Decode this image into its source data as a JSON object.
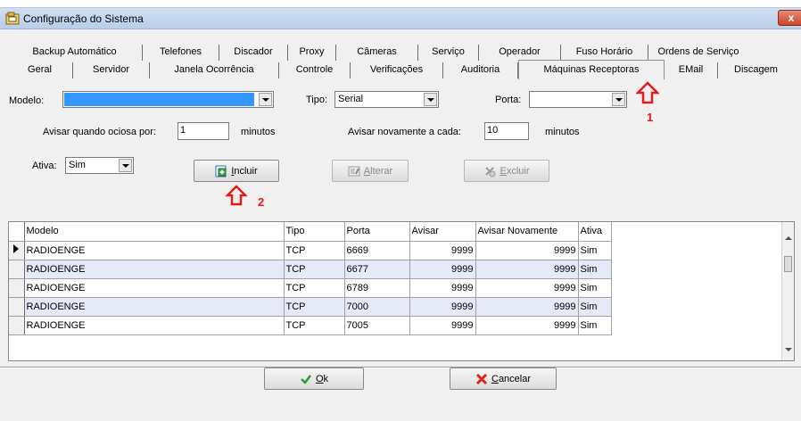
{
  "window": {
    "title": "Configuração do Sistema",
    "close_label": "x"
  },
  "tabs_row1": [
    "Backup Automático",
    "Telefones",
    "Discador",
    "Proxy",
    "Câmeras",
    "Serviço",
    "Operador",
    "Fuso Horário",
    "Ordens de Serviço"
  ],
  "tabs_row2": [
    "Geral",
    "Servidor",
    "Janela Ocorrência",
    "Controle",
    "Verificações",
    "Auditoria",
    "Máquinas Receptoras",
    "EMail",
    "Discagem"
  ],
  "active_tab": "Máquinas Receptoras",
  "form": {
    "modelo_label": "Modelo:",
    "modelo_value": "",
    "tipo_label": "Tipo:",
    "tipo_value": "Serial",
    "porta_label": "Porta:",
    "porta_value": "",
    "ociosa_label": "Avisar quando ociosa por:",
    "ociosa_value": "1",
    "minutos1": "minutos",
    "novamente_label": "Avisar novamente a cada:",
    "novamente_value": "10",
    "minutos2": "minutos",
    "ativa_label": "Ativa:",
    "ativa_value": "Sim"
  },
  "buttons": {
    "incluir": {
      "u": "I",
      "rest": "ncluir"
    },
    "alterar": {
      "u": "A",
      "rest": "lterar"
    },
    "excluir": {
      "u": "E",
      "rest": "xcluir"
    },
    "ok": {
      "u": "O",
      "rest": "k"
    },
    "cancelar": {
      "u": "C",
      "rest": "ancelar"
    }
  },
  "annotations": {
    "one": "1",
    "two": "2"
  },
  "table": {
    "headers": [
      "Modelo",
      "Tipo",
      "Porta",
      "Avisar",
      "Avisar Novamente",
      "Ativa"
    ],
    "rows": [
      [
        "RADIOENGE",
        "TCP",
        "6669",
        "9999",
        "9999",
        "Sim"
      ],
      [
        "RADIOENGE",
        "TCP",
        "6677",
        "9999",
        "9999",
        "Sim"
      ],
      [
        "RADIOENGE",
        "TCP",
        "6789",
        "9999",
        "9999",
        "Sim"
      ],
      [
        "RADIOENGE",
        "TCP",
        "7000",
        "9999",
        "9999",
        "Sim"
      ],
      [
        "RADIOENGE",
        "TCP",
        "7005",
        "9999",
        "9999",
        "Sim"
      ]
    ]
  },
  "colors": {
    "annotation": "#e31b1b",
    "selection": "#3399ff",
    "alt_row": "#e6e9f7"
  }
}
